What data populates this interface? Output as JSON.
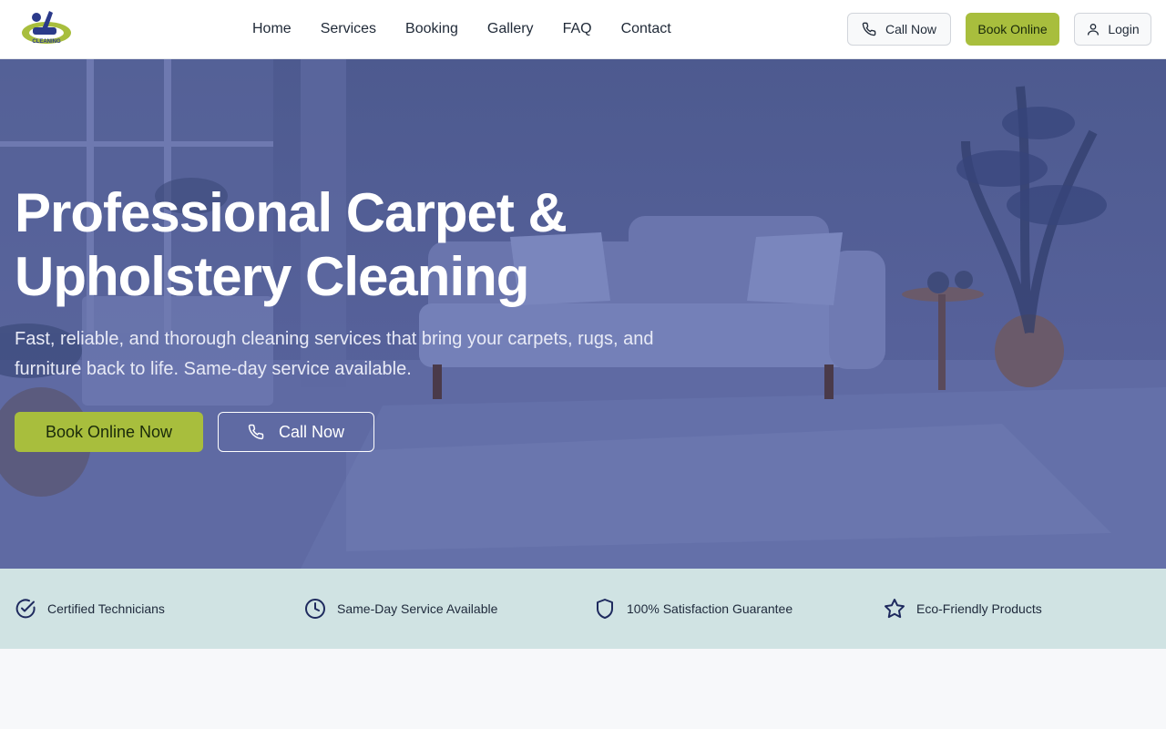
{
  "brand": {
    "logo_text": "CLEANING",
    "colors": {
      "accent": "#a8be3d",
      "navy": "#1e2a5e",
      "hero_overlay": "#4d5a8f",
      "strip": "#d0e3e3"
    }
  },
  "nav": {
    "items": [
      "Home",
      "Services",
      "Booking",
      "Gallery",
      "FAQ",
      "Contact"
    ]
  },
  "header_actions": {
    "call_label": "Call Now",
    "book_label": "Book Online",
    "login_label": "Login"
  },
  "hero": {
    "title": "Professional Carpet & Upholstery Cleaning",
    "subtitle": "Fast, reliable, and thorough cleaning services that bring your carpets, rugs, and furniture back to life. Same-day service available.",
    "primary_cta": "Book Online Now",
    "secondary_cta": "Call Now"
  },
  "features": [
    {
      "icon": "check-circle-icon",
      "label": "Certified Technicians"
    },
    {
      "icon": "clock-icon",
      "label": "Same-Day Service Available"
    },
    {
      "icon": "shield-icon",
      "label": "100% Satisfaction Guarantee"
    },
    {
      "icon": "star-icon",
      "label": "Eco-Friendly Products"
    }
  ]
}
